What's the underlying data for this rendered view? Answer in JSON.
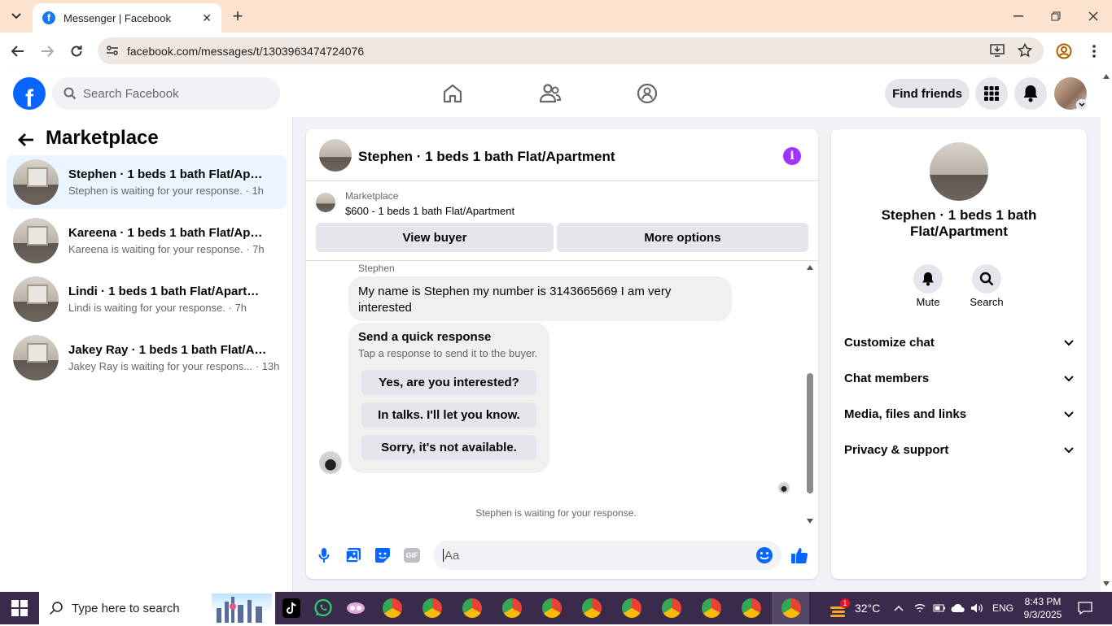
{
  "browser": {
    "tab_title": "Messenger | Facebook",
    "tab_favicon": "facebook-favicon",
    "url": "facebook.com/messages/t/1303963474724076",
    "new_tab": "+",
    "minimize": "—",
    "maximize": "❐",
    "close": "✕"
  },
  "header": {
    "search_placeholder": "Search Facebook",
    "find_friends": "Find friends"
  },
  "sidebar": {
    "title": "Marketplace",
    "conversations": [
      {
        "name": "Stephen · 1 beds 1 bath Flat/Apart...",
        "status": "Stephen is waiting for your response. · 1h"
      },
      {
        "name": "Kareena · 1 beds 1 bath Flat/Apart...",
        "status": "Kareena is waiting for your response. · 7h"
      },
      {
        "name": "Lindi · 1 beds 1 bath Flat/Apartment",
        "status": "Lindi is waiting for your response. · 7h"
      },
      {
        "name": "Jakey Ray · 1 beds 1 bath Flat/Apar...",
        "status": "Jakey Ray is waiting for your respons... · 13h"
      }
    ]
  },
  "chat": {
    "title": "Stephen · 1 beds 1 bath Flat/Apartment",
    "marketplace_label": "Marketplace",
    "listing": "$600 - 1 beds 1 bath Flat/Apartment",
    "view_buyer": "View buyer",
    "more_options": "More options",
    "sender": "Stephen",
    "message": "My name is Stephen  my number is 3143665669 I am very interested",
    "quick_title": "Send a quick response",
    "quick_subtitle": "Tap a response to send it to the buyer.",
    "quick_replies": [
      "Yes, are you interested?",
      "In talks. I'll let you know.",
      "Sorry, it's not available."
    ],
    "waiting": "Stephen is waiting for your response.",
    "input_placeholder": "Aa",
    "gif_label": "GIF"
  },
  "details": {
    "name": "Stephen · 1 beds 1 bath Flat/Apartment",
    "mute": "Mute",
    "search": "Search",
    "sections": [
      "Customize chat",
      "Chat members",
      "Media, files and links",
      "Privacy & support"
    ]
  },
  "taskbar": {
    "search_placeholder": "Type here to search",
    "weather_badge": "1",
    "temperature": "32°C",
    "language": "ENG",
    "time": "8:43 PM",
    "date": "9/3/2025"
  },
  "colors": {
    "facebook_blue": "#0866ff",
    "active_conv_bg": "#ebf5ff",
    "info_purple": "#a033ff",
    "taskbar": "#3a2a4b"
  }
}
